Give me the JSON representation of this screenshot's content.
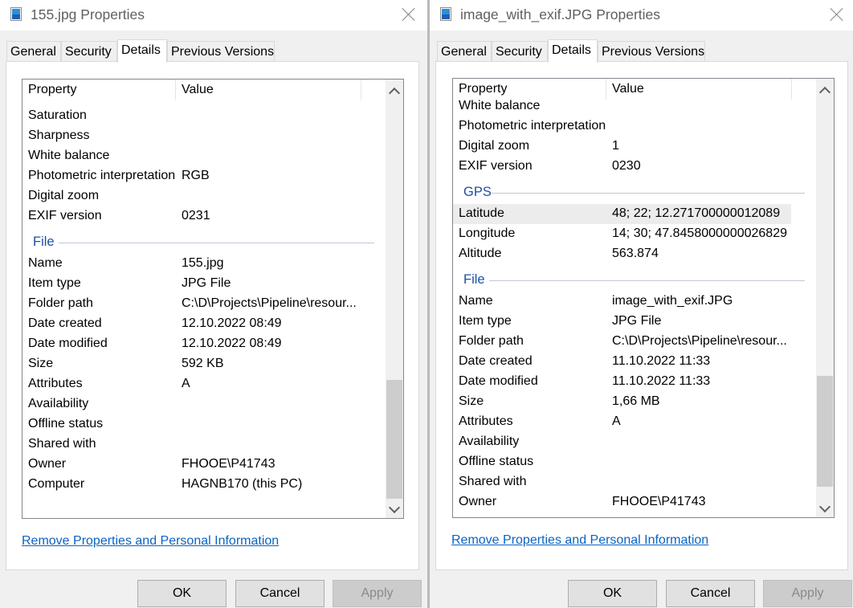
{
  "left": {
    "title": "155.jpg Properties",
    "tabs": [
      "General",
      "Security",
      "Details",
      "Previous Versions"
    ],
    "columns": {
      "property": "Property",
      "value": "Value"
    },
    "rows_top": [
      {
        "k": "Saturation",
        "v": ""
      },
      {
        "k": "Sharpness",
        "v": ""
      },
      {
        "k": "White balance",
        "v": ""
      },
      {
        "k": "Photometric interpretation",
        "v": "RGB"
      },
      {
        "k": "Digital zoom",
        "v": ""
      },
      {
        "k": "EXIF version",
        "v": "0231"
      }
    ],
    "group_file": "File",
    "rows_file": [
      {
        "k": "Name",
        "v": "155.jpg"
      },
      {
        "k": "Item type",
        "v": "JPG File"
      },
      {
        "k": "Folder path",
        "v": "C:\\D\\Projects\\Pipeline\\resour..."
      },
      {
        "k": "Date created",
        "v": "12.10.2022 08:49"
      },
      {
        "k": "Date modified",
        "v": "12.10.2022 08:49"
      },
      {
        "k": "Size",
        "v": "592 KB"
      },
      {
        "k": "Attributes",
        "v": "A"
      },
      {
        "k": "Availability",
        "v": ""
      },
      {
        "k": "Offline status",
        "v": ""
      },
      {
        "k": "Shared with",
        "v": ""
      },
      {
        "k": "Owner",
        "v": "FHOOE\\P41743"
      },
      {
        "k": "Computer",
        "v": "HAGNB170 (this PC)"
      }
    ],
    "link": "Remove Properties and Personal Information",
    "buttons": {
      "ok": "OK",
      "cancel": "Cancel",
      "apply": "Apply"
    }
  },
  "right": {
    "title": "image_with_exif.JPG Properties",
    "tabs": [
      "General",
      "Security",
      "Details",
      "Previous Versions"
    ],
    "columns": {
      "property": "Property",
      "value": "Value"
    },
    "rows_top": [
      {
        "k": "White balance",
        "v": ""
      },
      {
        "k": "Photometric interpretation",
        "v": ""
      },
      {
        "k": "Digital zoom",
        "v": "1"
      },
      {
        "k": "EXIF version",
        "v": "0230"
      }
    ],
    "group_gps": "GPS",
    "rows_gps": [
      {
        "k": "Latitude",
        "v": "48; 22; 12.271700000012089"
      },
      {
        "k": "Longitude",
        "v": "14; 30; 47.8458000000026829"
      },
      {
        "k": "Altitude",
        "v": "563.874"
      }
    ],
    "group_file": "File",
    "rows_file": [
      {
        "k": "Name",
        "v": "image_with_exif.JPG"
      },
      {
        "k": "Item type",
        "v": "JPG File"
      },
      {
        "k": "Folder path",
        "v": "C:\\D\\Projects\\Pipeline\\resour..."
      },
      {
        "k": "Date created",
        "v": "11.10.2022 11:33"
      },
      {
        "k": "Date modified",
        "v": "11.10.2022 11:33"
      },
      {
        "k": "Size",
        "v": "1,66 MB"
      },
      {
        "k": "Attributes",
        "v": "A"
      },
      {
        "k": "Availability",
        "v": ""
      },
      {
        "k": "Offline status",
        "v": ""
      },
      {
        "k": "Shared with",
        "v": ""
      },
      {
        "k": "Owner",
        "v": "FHOOE\\P41743"
      }
    ],
    "link": "Remove Properties and Personal Information",
    "buttons": {
      "ok": "OK",
      "cancel": "Cancel",
      "apply": "Apply"
    }
  },
  "icons": {
    "title": "image-file-icon",
    "close": "close-icon",
    "scroll_up": "chevron-up-icon",
    "scroll_down": "chevron-down-icon"
  },
  "colors": {
    "group_heading": "#1f4e9e",
    "link": "#0b63c1",
    "highlight_row": "#ececec"
  }
}
